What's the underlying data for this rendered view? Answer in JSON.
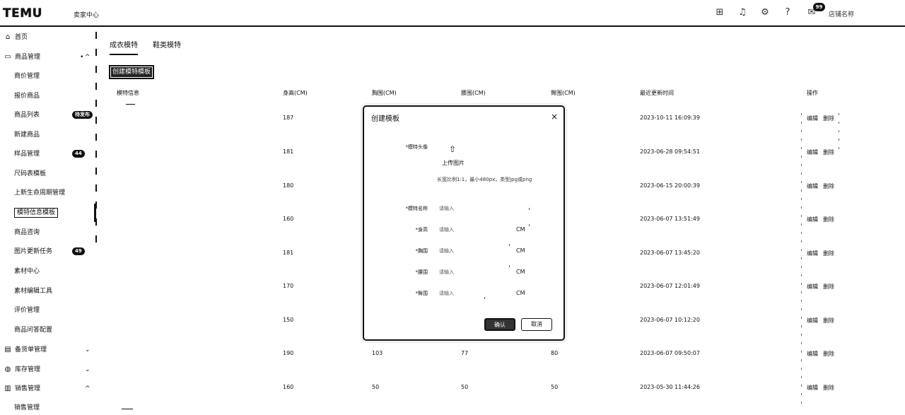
{
  "header": {
    "logo": "TEMU",
    "logo_sub": "卖家中心",
    "icons": [
      "apps-icon",
      "bell-icon",
      "settings-icon",
      "help-icon",
      "message-icon"
    ],
    "message_badge": "99",
    "user_name": "店铺名称"
  },
  "sidebar": {
    "items": [
      {
        "label": "首页",
        "icon": "⌂",
        "type": "top"
      },
      {
        "label": "商品管理",
        "icon": "▭",
        "type": "top",
        "expanded": true
      },
      {
        "label": "商价管理",
        "type": "sub"
      },
      {
        "label": "报价商品",
        "type": "sub"
      },
      {
        "label": "商品列表",
        "type": "sub",
        "badge": "待发布"
      },
      {
        "label": "新建商品",
        "type": "sub"
      },
      {
        "label": "样品管理",
        "type": "sub",
        "badge": "44"
      },
      {
        "label": "尺码表模板",
        "type": "sub"
      },
      {
        "label": "上新生命周期管理",
        "type": "sub"
      },
      {
        "label": "模特信息模板",
        "type": "sub",
        "active": true
      },
      {
        "label": "商品咨询",
        "type": "sub"
      },
      {
        "label": "图片更新任务",
        "type": "sub",
        "badge": "49"
      },
      {
        "label": "素材中心",
        "type": "sub"
      },
      {
        "label": "素材编辑工具",
        "type": "sub"
      },
      {
        "label": "评价管理",
        "type": "sub"
      },
      {
        "label": "商品问答配置",
        "type": "sub"
      },
      {
        "label": "备货单管理",
        "icon": "▤",
        "type": "top",
        "chevron": "down"
      },
      {
        "label": "库存管理",
        "icon": "◍",
        "type": "top",
        "chevron": "down"
      },
      {
        "label": "销售管理",
        "icon": "▥",
        "type": "top",
        "chevron": "up"
      },
      {
        "label": "销售管理",
        "type": "sub"
      }
    ]
  },
  "tabs": [
    {
      "label": "成衣模特",
      "active": true
    },
    {
      "label": "鞋类模特",
      "active": false
    }
  ],
  "create_button": "创建模特模板",
  "table": {
    "headers": [
      "模特信息",
      "身高(CM)",
      "胸围(CM)",
      "腰围(CM)",
      "臀围(CM)",
      "最近更新时间",
      "操作"
    ],
    "rows": [
      {
        "height": "187",
        "bust": "",
        "waist": "",
        "hip": "",
        "updated": "2023-10-11 16:09:39",
        "actions": [
          "编辑",
          "删除"
        ]
      },
      {
        "height": "181",
        "bust": "",
        "waist": "",
        "hip": "",
        "updated": "2023-06-28 09:54:51",
        "actions": [
          "编辑",
          "删除"
        ]
      },
      {
        "height": "180",
        "bust": "",
        "waist": "",
        "hip": "",
        "updated": "2023-06-15 20:00:39",
        "actions": [
          "编辑",
          "删除"
        ]
      },
      {
        "height": "160",
        "bust": "",
        "waist": "",
        "hip": "",
        "updated": "2023-06-07 13:51:49",
        "actions": [
          "编辑",
          "删除"
        ]
      },
      {
        "height": "181",
        "bust": "",
        "waist": "",
        "hip": "",
        "updated": "2023-06-07 13:45:20",
        "actions": [
          "编辑",
          "删除"
        ]
      },
      {
        "height": "170",
        "bust": "",
        "waist": "",
        "hip": "",
        "updated": "2023-06-07 12:01:49",
        "actions": [
          "编辑",
          "删除"
        ]
      },
      {
        "height": "150",
        "bust": "",
        "waist": "",
        "hip": "",
        "updated": "2023-06-07 10:12:20",
        "actions": [
          "编辑",
          "删除"
        ]
      },
      {
        "height": "190",
        "bust": "103",
        "waist": "77",
        "hip": "80",
        "updated": "2023-06-07 09:50:07",
        "actions": [
          "编辑",
          "删除"
        ]
      },
      {
        "height": "160",
        "bust": "50",
        "waist": "50",
        "hip": "50",
        "updated": "2023-05-30 11:44:26",
        "actions": [
          "编辑",
          "删除"
        ]
      }
    ]
  },
  "modal": {
    "title": "创建模板",
    "close": "×",
    "avatar_label": "*模特头像",
    "upload_text": "上传图片",
    "upload_hint": "长宽比例1:1，最小480px，类型jpg或png",
    "name_label": "*模特名称",
    "name_placeholder": "请输入",
    "height_label": "*身高",
    "height_placeholder": "请输入",
    "bust_label": "*胸围",
    "bust_placeholder": "请输入",
    "waist_label": "*腰围",
    "waist_placeholder": "请输入",
    "hip_label": "*臀围",
    "hip_placeholder": "请输入",
    "unit": "CM",
    "ok": "确认",
    "cancel": "取消"
  }
}
